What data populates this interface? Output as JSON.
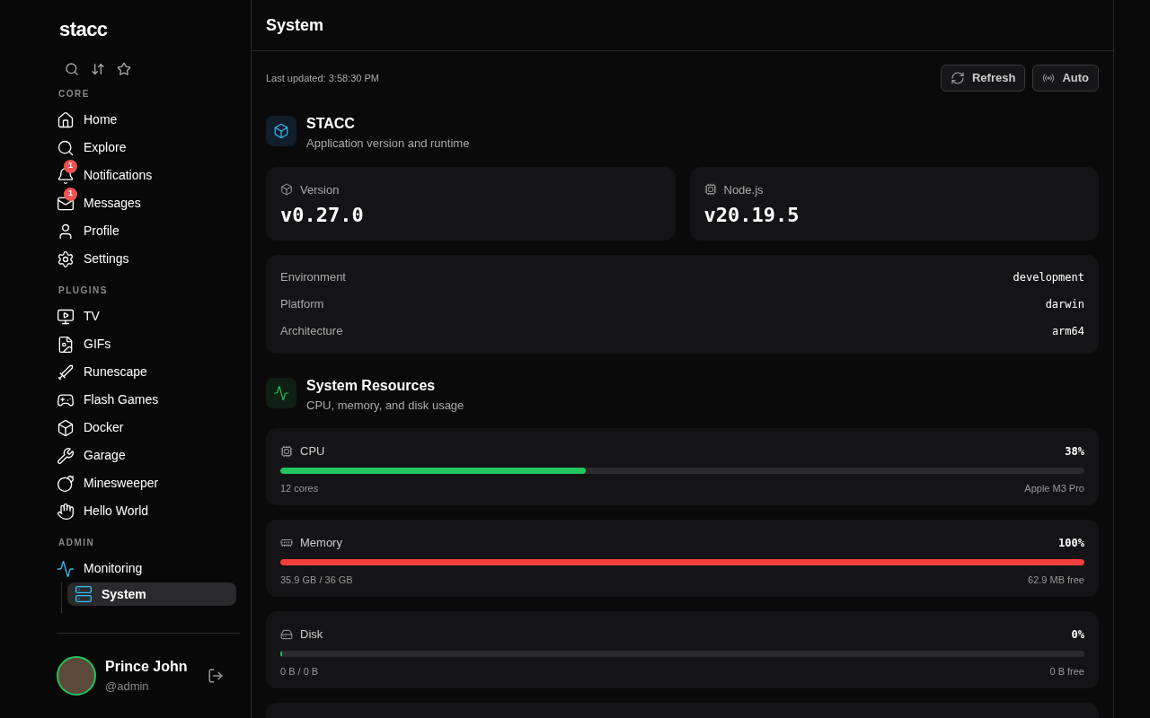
{
  "sidebar": {
    "logo": "stacc",
    "sections": [
      {
        "heading": "CORE",
        "items": [
          {
            "label": "Home",
            "selected": false
          },
          {
            "label": "Explore",
            "selected": false
          },
          {
            "label": "Notifications",
            "badge": "1",
            "selected": false
          },
          {
            "label": "Messages",
            "badge": "1",
            "selected": false
          },
          {
            "label": "Profile",
            "selected": false
          },
          {
            "label": "Settings",
            "selected": false
          }
        ]
      },
      {
        "heading": "PLUGINS",
        "items": [
          {
            "label": "TV",
            "selected": false
          },
          {
            "label": "GIFs",
            "selected": false
          },
          {
            "label": "Runescape",
            "selected": false
          },
          {
            "label": "Flash Games",
            "selected": false
          },
          {
            "label": "Docker",
            "selected": false
          },
          {
            "label": "Garage",
            "selected": false
          },
          {
            "label": "Minesweeper",
            "selected": false
          },
          {
            "label": "Hello World",
            "selected": false
          }
        ]
      },
      {
        "heading": "ADMIN",
        "items": [
          {
            "label": "Monitoring",
            "selected": false,
            "children": [
              {
                "label": "System",
                "selected": true
              }
            ]
          }
        ]
      }
    ],
    "user": {
      "name": "Prince John",
      "handle": "@admin"
    }
  },
  "page": {
    "title": "System",
    "last_updated": "Last updated: 3:58:30 PM",
    "buttons": [
      "Refresh",
      "Auto"
    ]
  },
  "app_section": {
    "title": "STACC",
    "subtitle": "Application version and runtime",
    "stats": [
      {
        "label": "Version",
        "value": "v0.27.0"
      },
      {
        "label": "Node.js",
        "value": "v20.19.5"
      }
    ],
    "details": [
      {
        "label": "Environment",
        "value": "development"
      },
      {
        "label": "Platform",
        "value": "darwin"
      },
      {
        "label": "Architecture",
        "value": "arm64"
      }
    ]
  },
  "resources_section": {
    "title": "System Resources",
    "subtitle": "CPU, memory, and disk usage",
    "resources": [
      {
        "label": "CPU",
        "reading": "38%",
        "level": 0.38,
        "left": "12 cores",
        "right": "Apple M3 Pro"
      },
      {
        "label": "Memory",
        "reading": "100%",
        "level": 1.0,
        "left": "35.9 GB / 36 GB",
        "right": "62.9 MB free"
      },
      {
        "label": "Disk",
        "reading": "0%",
        "level": 0,
        "left": "0 B / 0 B",
        "right": "0 B free"
      }
    ]
  }
}
